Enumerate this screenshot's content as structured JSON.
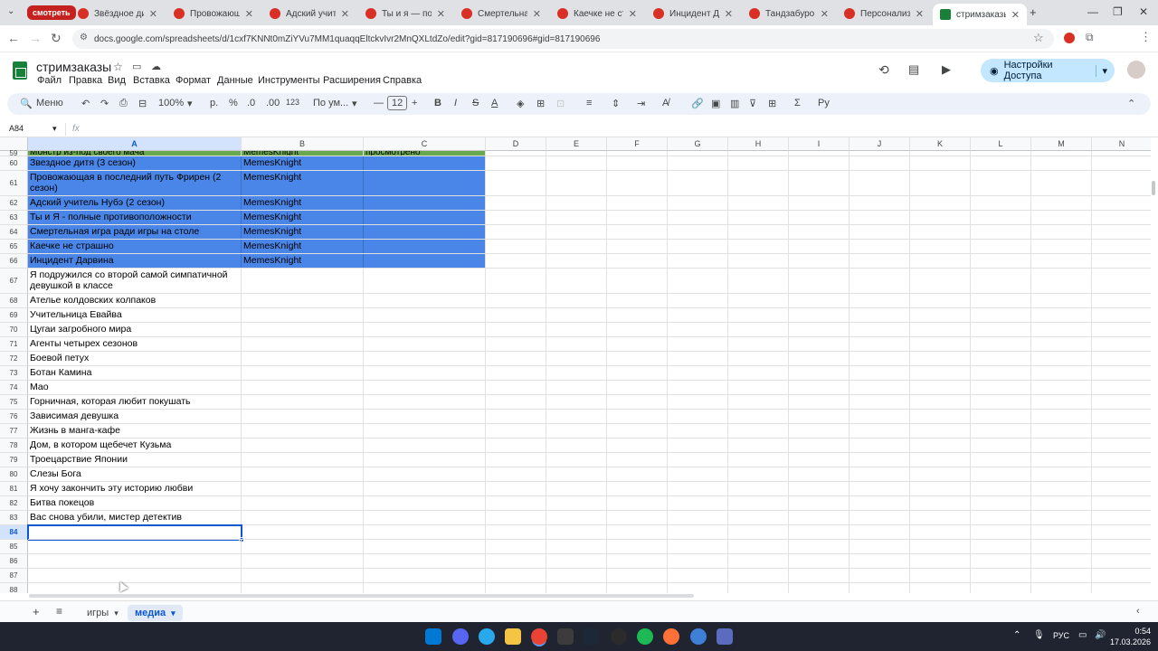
{
  "browser": {
    "group_label": "смотреть",
    "tabs": [
      {
        "title": "Звёздное дитя"
      },
      {
        "title": "Провожающая"
      },
      {
        "title": "Адский учитель"
      },
      {
        "title": "Ты и я — полн"
      },
      {
        "title": "Смертельная и"
      },
      {
        "title": "Каечке не стра"
      },
      {
        "title": "Инцидент Дарв"
      },
      {
        "title": "Тандзабуро То"
      },
      {
        "title": "Персонализир"
      },
      {
        "title": "стримзаказы"
      }
    ],
    "url": "docs.google.com/spreadsheets/d/1cxf7KNNt0mZiYVu7MM1quaqqEltckvIvr2MnQXLtdZo/edit?gid=817190696#gid=817190696"
  },
  "sheets": {
    "title": "стримзаказы",
    "menu": [
      "Файл",
      "Правка",
      "Вид",
      "Вставка",
      "Формат",
      "Данные",
      "Инструменты",
      "Расширения",
      "Справка"
    ],
    "share_label": "Настройки Доступа",
    "toolbar": {
      "search_label": "Меню",
      "zoom": "100%",
      "currency": "р.",
      "percent": "%",
      "dec_less": ".0",
      "dec_more": ".00",
      "number_format": "123",
      "font": "По ум...",
      "font_size": "12"
    },
    "name_box": "A84",
    "fx": "fx"
  },
  "grid": {
    "columns": [
      "A",
      "B",
      "C",
      "D",
      "E",
      "F",
      "G",
      "H",
      "I",
      "J",
      "K",
      "L",
      "M",
      "N"
    ],
    "rows": [
      {
        "num": "59",
        "a": "Монстр из-под своего мача",
        "b": "MemesKnight",
        "c": "просмотрено",
        "style": "green"
      },
      {
        "num": "60",
        "a": "Звездное дитя (3 сезон)",
        "b": "MemesKnight",
        "c": "",
        "style": "blue"
      },
      {
        "num": "61",
        "a": "Провожающая в последний путь Фрирен (2 сезон)",
        "b": "MemesKnight",
        "c": "",
        "style": "blue"
      },
      {
        "num": "62",
        "a": "Адский учитель Нубэ (2 сезон)",
        "b": "MemesKnight",
        "c": "",
        "style": "blue"
      },
      {
        "num": "63",
        "a": "Ты и Я - полные противоположности",
        "b": "MemesKnight",
        "c": "",
        "style": "blue"
      },
      {
        "num": "64",
        "a": "Смертельная игра ради игры на столе",
        "b": "MemesKnight",
        "c": "",
        "style": "blue"
      },
      {
        "num": "65",
        "a": "Каечке не страшно",
        "b": "MemesKnight",
        "c": "",
        "style": "blue"
      },
      {
        "num": "66",
        "a": "Инцидент Дарвина",
        "b": "MemesKnight",
        "c": "",
        "style": "blue"
      },
      {
        "num": "67",
        "a": "Я подружился со второй самой симпатичной девушкой в классе",
        "b": "",
        "c": "",
        "style": ""
      },
      {
        "num": "68",
        "a": "Ателье колдовских колпаков",
        "b": "",
        "c": "",
        "style": ""
      },
      {
        "num": "69",
        "a": "Учительница Евайва",
        "b": "",
        "c": "",
        "style": ""
      },
      {
        "num": "70",
        "a": "Цугаи загробного мира",
        "b": "",
        "c": "",
        "style": ""
      },
      {
        "num": "71",
        "a": "Агенты четырех сезонов",
        "b": "",
        "c": "",
        "style": ""
      },
      {
        "num": "72",
        "a": "Боевой петух",
        "b": "",
        "c": "",
        "style": ""
      },
      {
        "num": "73",
        "a": "Ботан Камина",
        "b": "",
        "c": "",
        "style": ""
      },
      {
        "num": "74",
        "a": "Мао",
        "b": "",
        "c": "",
        "style": ""
      },
      {
        "num": "75",
        "a": "Горничная, которая любит покушать",
        "b": "",
        "c": "",
        "style": ""
      },
      {
        "num": "76",
        "a": "Зависимая девушка",
        "b": "",
        "c": "",
        "style": ""
      },
      {
        "num": "77",
        "a": "Жизнь в манга-кафе",
        "b": "",
        "c": "",
        "style": ""
      },
      {
        "num": "78",
        "a": "Дом, в котором щебечет Кузьма",
        "b": "",
        "c": "",
        "style": ""
      },
      {
        "num": "79",
        "a": "Троецарствие Японии",
        "b": "",
        "c": "",
        "style": ""
      },
      {
        "num": "80",
        "a": "Слезы Бога",
        "b": "",
        "c": "",
        "style": ""
      },
      {
        "num": "81",
        "a": "Я хочу закончить эту историю любви",
        "b": "",
        "c": "",
        "style": ""
      },
      {
        "num": "82",
        "a": "Битва покецов",
        "b": "",
        "c": "",
        "style": ""
      },
      {
        "num": "83",
        "a": "Вас снова убили, мистер детектив",
        "b": "",
        "c": "",
        "style": ""
      },
      {
        "num": "84",
        "a": "",
        "b": "",
        "c": "",
        "style": "selected"
      },
      {
        "num": "85",
        "a": "",
        "b": "",
        "c": "",
        "style": ""
      },
      {
        "num": "86",
        "a": "",
        "b": "",
        "c": "",
        "style": ""
      },
      {
        "num": "87",
        "a": "",
        "b": "",
        "c": "",
        "style": ""
      },
      {
        "num": "88",
        "a": "",
        "b": "",
        "c": "",
        "style": ""
      }
    ]
  },
  "sheet_tabs": [
    {
      "label": "игры",
      "active": false
    },
    {
      "label": "медиа",
      "active": true
    }
  ],
  "taskbar": {
    "lang": "РУС",
    "time": "0:54",
    "date": "17.03.2026"
  }
}
